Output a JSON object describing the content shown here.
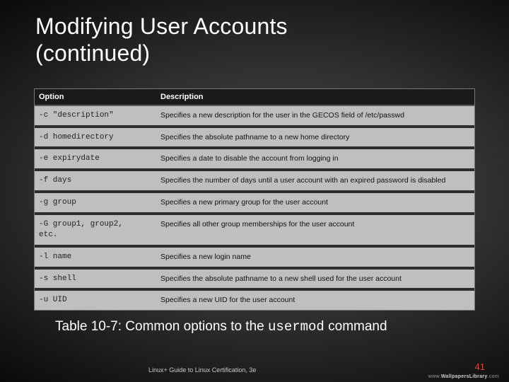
{
  "title_line1": "Modifying User Accounts",
  "title_line2": "(continued)",
  "table": {
    "headers": {
      "option": "Option",
      "description": "Description"
    },
    "rows": [
      {
        "opt": "-c \"description\"",
        "desc": "Specifies a new description for the user in the GECOS field of /etc/passwd"
      },
      {
        "opt": "-d homedirectory",
        "desc": "Specifies the absolute pathname to a new home directory"
      },
      {
        "opt": "-e expirydate",
        "desc": "Specifies a date to disable the account from logging in"
      },
      {
        "opt": "-f days",
        "desc": "Specifies the number of days until a user account with an expired password is disabled"
      },
      {
        "opt": "-g group",
        "desc": "Specifies a new primary group for the user account"
      },
      {
        "opt": "-G group1, group2,\netc.",
        "desc": "Specifies all other group memberships for the user account"
      },
      {
        "opt": "-l name",
        "desc": "Specifies a new login name"
      },
      {
        "opt": "-s shell",
        "desc": "Specifies the absolute pathname to a new shell used for the user account"
      },
      {
        "opt": "-u UID",
        "desc": "Specifies a new UID for the user account"
      }
    ]
  },
  "caption": {
    "prefix": "Table 10-7: Common options to the ",
    "cmd": "usermod",
    "suffix": " command"
  },
  "footer": {
    "left": "Linux+ Guide to Linux Certification, 3e",
    "page": "41",
    "watermark_a": "www.",
    "watermark_b": "Wallpapers",
    "watermark_c": "Library",
    "watermark_d": ".com"
  }
}
